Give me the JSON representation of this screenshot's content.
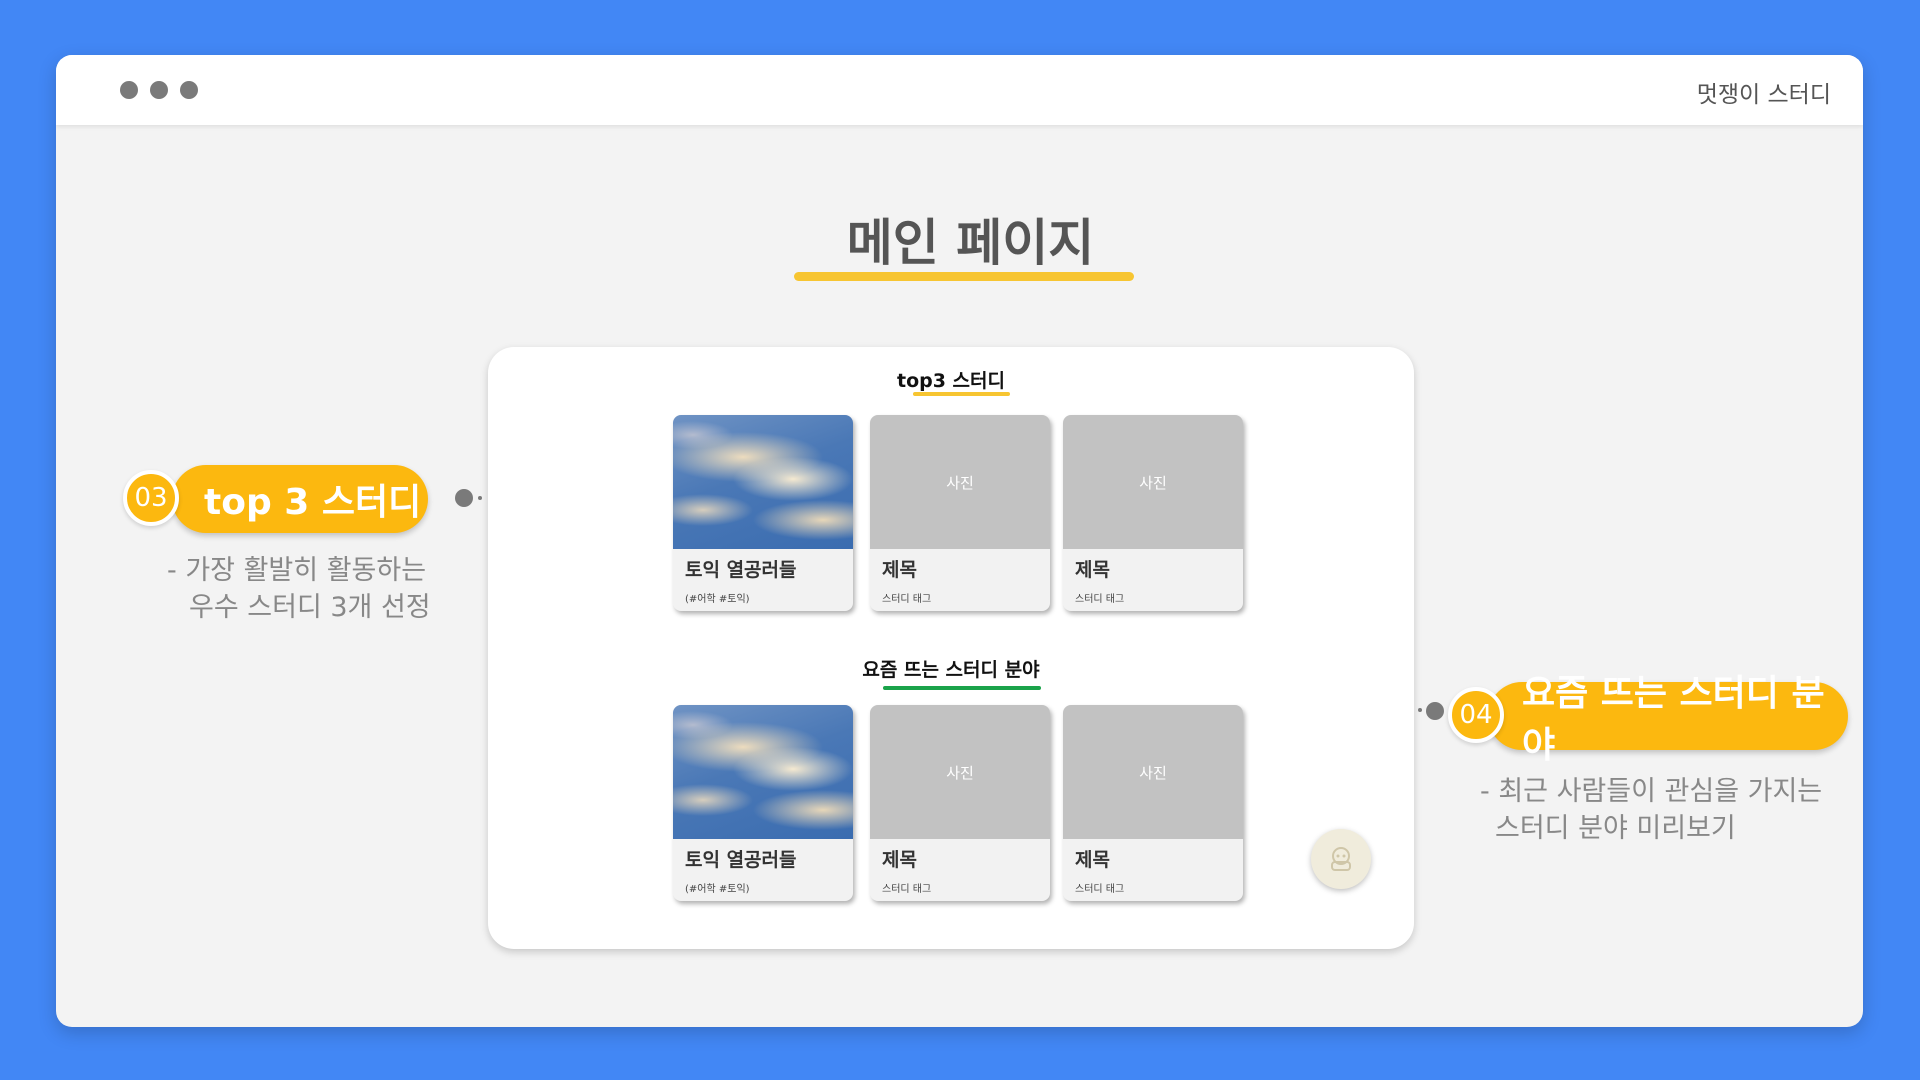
{
  "window": {
    "app_name": "멋쟁이 스터디"
  },
  "page": {
    "title": "메인 페이지"
  },
  "sections": [
    {
      "label": "top3 스터디",
      "underline_color": "#f7c531",
      "cards": [
        {
          "image": "sky-photo",
          "title": "토익 열공러들",
          "tag": "(#어학 #토익)"
        },
        {
          "image": "사진",
          "title": "제목",
          "tag": "스터디 태그"
        },
        {
          "image": "사진",
          "title": "제목",
          "tag": "스터디 태그"
        }
      ]
    },
    {
      "label": "요즘 뜨는 스터디 분야",
      "underline_color": "#1aa34a",
      "cards": [
        {
          "image": "sky-photo",
          "title": "토익 열공러들",
          "tag": "(#어학 #토익)"
        },
        {
          "image": "사진",
          "title": "제목",
          "tag": "스터디 태그"
        },
        {
          "image": "사진",
          "title": "제목",
          "tag": "스터디 태그"
        }
      ]
    }
  ],
  "callouts": [
    {
      "number": "03",
      "label": "top 3 스터디",
      "desc_lines": [
        "- 가장 활발히 활동하는",
        "우수 스터디 3개 선정"
      ]
    },
    {
      "number": "04",
      "label": "요즘 뜨는 스터디 분야",
      "desc_lines": [
        "- 최근 사람들이 관심을 가지는",
        "스터디 분야 미리보기"
      ]
    }
  ],
  "colors": {
    "background": "#4287f5",
    "accent": "#fcb80f"
  },
  "icons": {
    "chat_button": "chatbot-icon"
  }
}
